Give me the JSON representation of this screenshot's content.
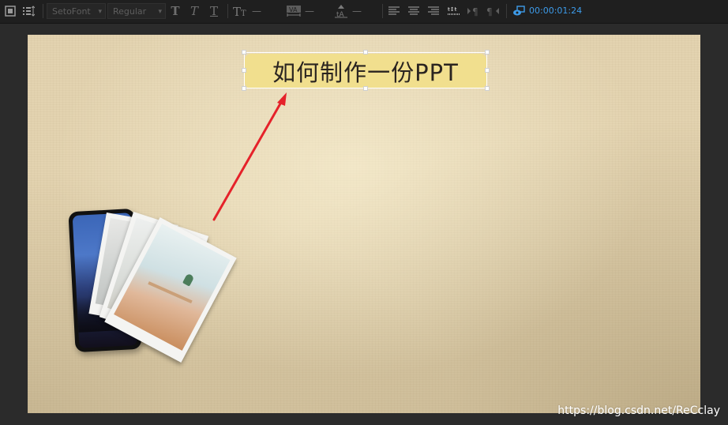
{
  "toolbar": {
    "font_family": "SetoFont",
    "font_style": "Regular",
    "bold_glyph": "T",
    "italic_glyph": "T",
    "underline_glyph": "T",
    "dash": "—",
    "timecode": "00:00:01:24"
  },
  "canvas": {
    "title": "如何制作一份PPT"
  },
  "watermark": "https://blog.csdn.net/ReCclay",
  "colors": {
    "accent_blue": "#3d9be9",
    "title_bg": "#f1df8e",
    "arrow": "#e5222a",
    "canvas_bg": "#e3d3b0"
  }
}
